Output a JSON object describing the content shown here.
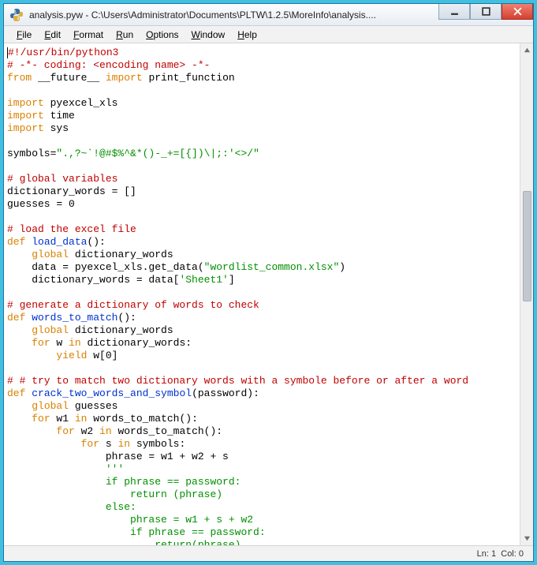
{
  "titlebar": {
    "title": "analysis.pyw - C:\\Users\\Administrator\\Documents\\PLTW\\1.2.5\\MoreInfo\\analysis...."
  },
  "menubar": {
    "items": [
      {
        "u": "F",
        "rest": "ile"
      },
      {
        "u": "E",
        "rest": "dit"
      },
      {
        "u": "F",
        "rest": "ormat"
      },
      {
        "u": "R",
        "rest": "un"
      },
      {
        "u": "O",
        "rest": "ptions"
      },
      {
        "u": "W",
        "rest": "indow"
      },
      {
        "u": "H",
        "rest": "elp"
      }
    ]
  },
  "statusbar": {
    "line_label": "Ln:",
    "line_val": "1",
    "col_label": "Col:",
    "col_val": "0"
  },
  "code": {
    "l1a": "#!/usr/bin/python3",
    "l2a": "# -*- coding: <encoding name> -*-",
    "l3a": "from",
    "l3b": " __future__ ",
    "l3c": "import",
    "l3d": " print_function",
    "l5a": "import",
    "l5b": " pyexcel_xls",
    "l6a": "import",
    "l6b": " time",
    "l7a": "import",
    "l7b": " sys",
    "l9a": "symbols=",
    "l9b": "\".,?~`!@#$%^&*()-_+=[{])\\|;:'<>/\"",
    "l11a": "# global variables",
    "l12a": "dictionary_words = []",
    "l13a": "guesses = ",
    "l13b": "0",
    "l15a": "# load the excel file",
    "l16a": "def",
    "l16b": " ",
    "l16c": "load_data",
    "l16d": "():",
    "l17a": "    ",
    "l17b": "global",
    "l17c": " dictionary_words",
    "l18a": "    data = pyexcel_xls.get_data(",
    "l18b": "\"wordlist_common.xlsx\"",
    "l18c": ")",
    "l19a": "    dictionary_words = data[",
    "l19b": "'Sheet1'",
    "l19c": "]",
    "l21a": "# generate a dictionary of words to check",
    "l22a": "def",
    "l22b": " ",
    "l22c": "words_to_match",
    "l22d": "():",
    "l23a": "    ",
    "l23b": "global",
    "l23c": " dictionary_words",
    "l24a": "    ",
    "l24b": "for",
    "l24c": " w ",
    "l24d": "in",
    "l24e": " dictionary_words:",
    "l25a": "        ",
    "l25b": "yield",
    "l25c": " w[",
    "l25d": "0",
    "l25e": "]",
    "l27a": "# # try to match two dictionary words with a symbole before or after a word",
    "l28a": "def",
    "l28b": " ",
    "l28c": "crack_two_words_and_symbol",
    "l28d": "(password):",
    "l29a": "    ",
    "l29b": "global",
    "l29c": " guesses",
    "l30a": "    ",
    "l30b": "for",
    "l30c": " w1 ",
    "l30d": "in",
    "l30e": " words_to_match():",
    "l31a": "        ",
    "l31b": "for",
    "l31c": " w2 ",
    "l31d": "in",
    "l31e": " words_to_match():",
    "l32a": "            ",
    "l32b": "for",
    "l32c": " s ",
    "l32d": "in",
    "l32e": " symbols:",
    "l33a": "                phrase = w1 + w2 + s",
    "l34a": "                ",
    "l34b": "'''",
    "l35a": "                if phrase == password:",
    "l36a": "                    return (phrase)",
    "l37a": "                else:",
    "l38a": "                    phrase = w1 + s + w2",
    "l39a": "                    if phrase == password:",
    "l40a": "                        return(phrase)"
  }
}
